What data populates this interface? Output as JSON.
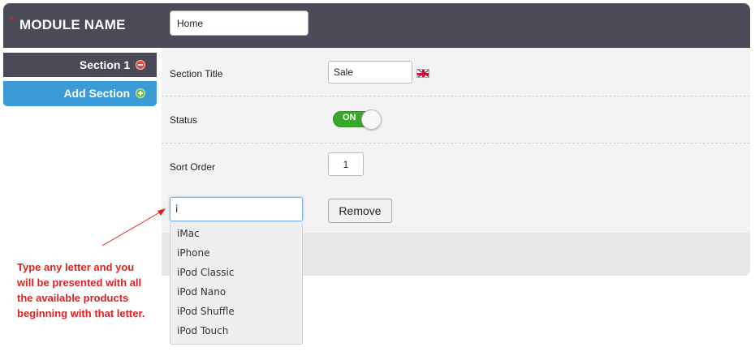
{
  "header": {
    "required_marker": "*",
    "title": "MODULE NAME",
    "module_name_value": "Home"
  },
  "tabs": [
    {
      "label": "Section 1",
      "icon": "minus-circle-icon",
      "active": true
    },
    {
      "label": "Add Section",
      "icon": "plus-circle-icon",
      "active": false
    }
  ],
  "form": {
    "section_title_label": "Section Title",
    "section_title_value": "Sale",
    "language_flag": "uk-flag-icon",
    "status_label": "Status",
    "status_toggle_text": "ON",
    "status_on": true,
    "sort_order_label": "Sort Order",
    "sort_order_value": "1",
    "product_search_value": "i",
    "remove_button": "Remove"
  },
  "autocomplete": [
    "iMac",
    "iPhone",
    "iPod Classic",
    "iPod Nano",
    "iPod Shuffle",
    "iPod Touch"
  ],
  "annotation": "Type any letter and you will be presented with all the available products beginning with that letter.",
  "colors": {
    "header_bg": "#4a4b57",
    "add_tab_bg": "#3b9bd6",
    "toggle_on": "#3aa82c",
    "annotation": "#e02020"
  }
}
